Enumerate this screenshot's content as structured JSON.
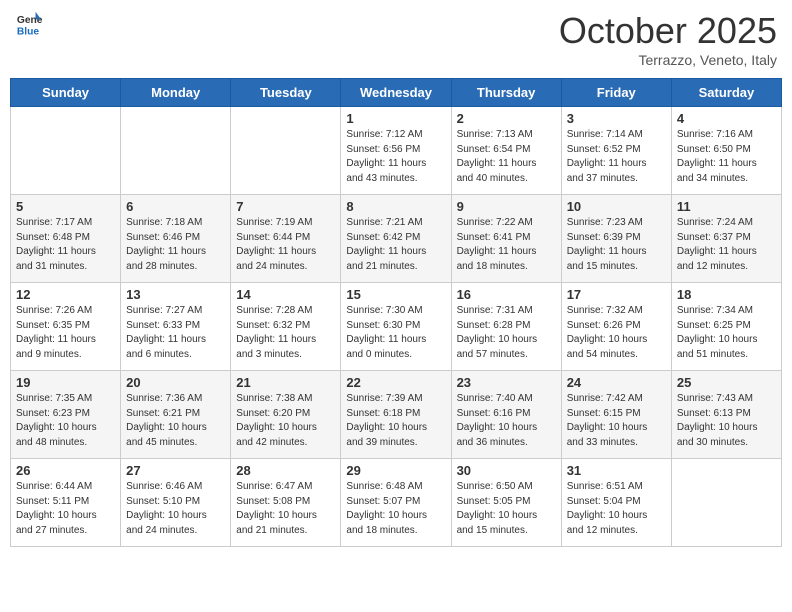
{
  "header": {
    "logo": {
      "line1": "General",
      "line2": "Blue"
    },
    "title": "October 2025",
    "subtitle": "Terrazzo, Veneto, Italy"
  },
  "days_of_week": [
    "Sunday",
    "Monday",
    "Tuesday",
    "Wednesday",
    "Thursday",
    "Friday",
    "Saturday"
  ],
  "weeks": [
    [
      {
        "day": "",
        "info": ""
      },
      {
        "day": "",
        "info": ""
      },
      {
        "day": "",
        "info": ""
      },
      {
        "day": "1",
        "info": "Sunrise: 7:12 AM\nSunset: 6:56 PM\nDaylight: 11 hours and 43 minutes."
      },
      {
        "day": "2",
        "info": "Sunrise: 7:13 AM\nSunset: 6:54 PM\nDaylight: 11 hours and 40 minutes."
      },
      {
        "day": "3",
        "info": "Sunrise: 7:14 AM\nSunset: 6:52 PM\nDaylight: 11 hours and 37 minutes."
      },
      {
        "day": "4",
        "info": "Sunrise: 7:16 AM\nSunset: 6:50 PM\nDaylight: 11 hours and 34 minutes."
      }
    ],
    [
      {
        "day": "5",
        "info": "Sunrise: 7:17 AM\nSunset: 6:48 PM\nDaylight: 11 hours and 31 minutes."
      },
      {
        "day": "6",
        "info": "Sunrise: 7:18 AM\nSunset: 6:46 PM\nDaylight: 11 hours and 28 minutes."
      },
      {
        "day": "7",
        "info": "Sunrise: 7:19 AM\nSunset: 6:44 PM\nDaylight: 11 hours and 24 minutes."
      },
      {
        "day": "8",
        "info": "Sunrise: 7:21 AM\nSunset: 6:42 PM\nDaylight: 11 hours and 21 minutes."
      },
      {
        "day": "9",
        "info": "Sunrise: 7:22 AM\nSunset: 6:41 PM\nDaylight: 11 hours and 18 minutes."
      },
      {
        "day": "10",
        "info": "Sunrise: 7:23 AM\nSunset: 6:39 PM\nDaylight: 11 hours and 15 minutes."
      },
      {
        "day": "11",
        "info": "Sunrise: 7:24 AM\nSunset: 6:37 PM\nDaylight: 11 hours and 12 minutes."
      }
    ],
    [
      {
        "day": "12",
        "info": "Sunrise: 7:26 AM\nSunset: 6:35 PM\nDaylight: 11 hours and 9 minutes."
      },
      {
        "day": "13",
        "info": "Sunrise: 7:27 AM\nSunset: 6:33 PM\nDaylight: 11 hours and 6 minutes."
      },
      {
        "day": "14",
        "info": "Sunrise: 7:28 AM\nSunset: 6:32 PM\nDaylight: 11 hours and 3 minutes."
      },
      {
        "day": "15",
        "info": "Sunrise: 7:30 AM\nSunset: 6:30 PM\nDaylight: 11 hours and 0 minutes."
      },
      {
        "day": "16",
        "info": "Sunrise: 7:31 AM\nSunset: 6:28 PM\nDaylight: 10 hours and 57 minutes."
      },
      {
        "day": "17",
        "info": "Sunrise: 7:32 AM\nSunset: 6:26 PM\nDaylight: 10 hours and 54 minutes."
      },
      {
        "day": "18",
        "info": "Sunrise: 7:34 AM\nSunset: 6:25 PM\nDaylight: 10 hours and 51 minutes."
      }
    ],
    [
      {
        "day": "19",
        "info": "Sunrise: 7:35 AM\nSunset: 6:23 PM\nDaylight: 10 hours and 48 minutes."
      },
      {
        "day": "20",
        "info": "Sunrise: 7:36 AM\nSunset: 6:21 PM\nDaylight: 10 hours and 45 minutes."
      },
      {
        "day": "21",
        "info": "Sunrise: 7:38 AM\nSunset: 6:20 PM\nDaylight: 10 hours and 42 minutes."
      },
      {
        "day": "22",
        "info": "Sunrise: 7:39 AM\nSunset: 6:18 PM\nDaylight: 10 hours and 39 minutes."
      },
      {
        "day": "23",
        "info": "Sunrise: 7:40 AM\nSunset: 6:16 PM\nDaylight: 10 hours and 36 minutes."
      },
      {
        "day": "24",
        "info": "Sunrise: 7:42 AM\nSunset: 6:15 PM\nDaylight: 10 hours and 33 minutes."
      },
      {
        "day": "25",
        "info": "Sunrise: 7:43 AM\nSunset: 6:13 PM\nDaylight: 10 hours and 30 minutes."
      }
    ],
    [
      {
        "day": "26",
        "info": "Sunrise: 6:44 AM\nSunset: 5:11 PM\nDaylight: 10 hours and 27 minutes."
      },
      {
        "day": "27",
        "info": "Sunrise: 6:46 AM\nSunset: 5:10 PM\nDaylight: 10 hours and 24 minutes."
      },
      {
        "day": "28",
        "info": "Sunrise: 6:47 AM\nSunset: 5:08 PM\nDaylight: 10 hours and 21 minutes."
      },
      {
        "day": "29",
        "info": "Sunrise: 6:48 AM\nSunset: 5:07 PM\nDaylight: 10 hours and 18 minutes."
      },
      {
        "day": "30",
        "info": "Sunrise: 6:50 AM\nSunset: 5:05 PM\nDaylight: 10 hours and 15 minutes."
      },
      {
        "day": "31",
        "info": "Sunrise: 6:51 AM\nSunset: 5:04 PM\nDaylight: 10 hours and 12 minutes."
      },
      {
        "day": "",
        "info": ""
      }
    ]
  ]
}
